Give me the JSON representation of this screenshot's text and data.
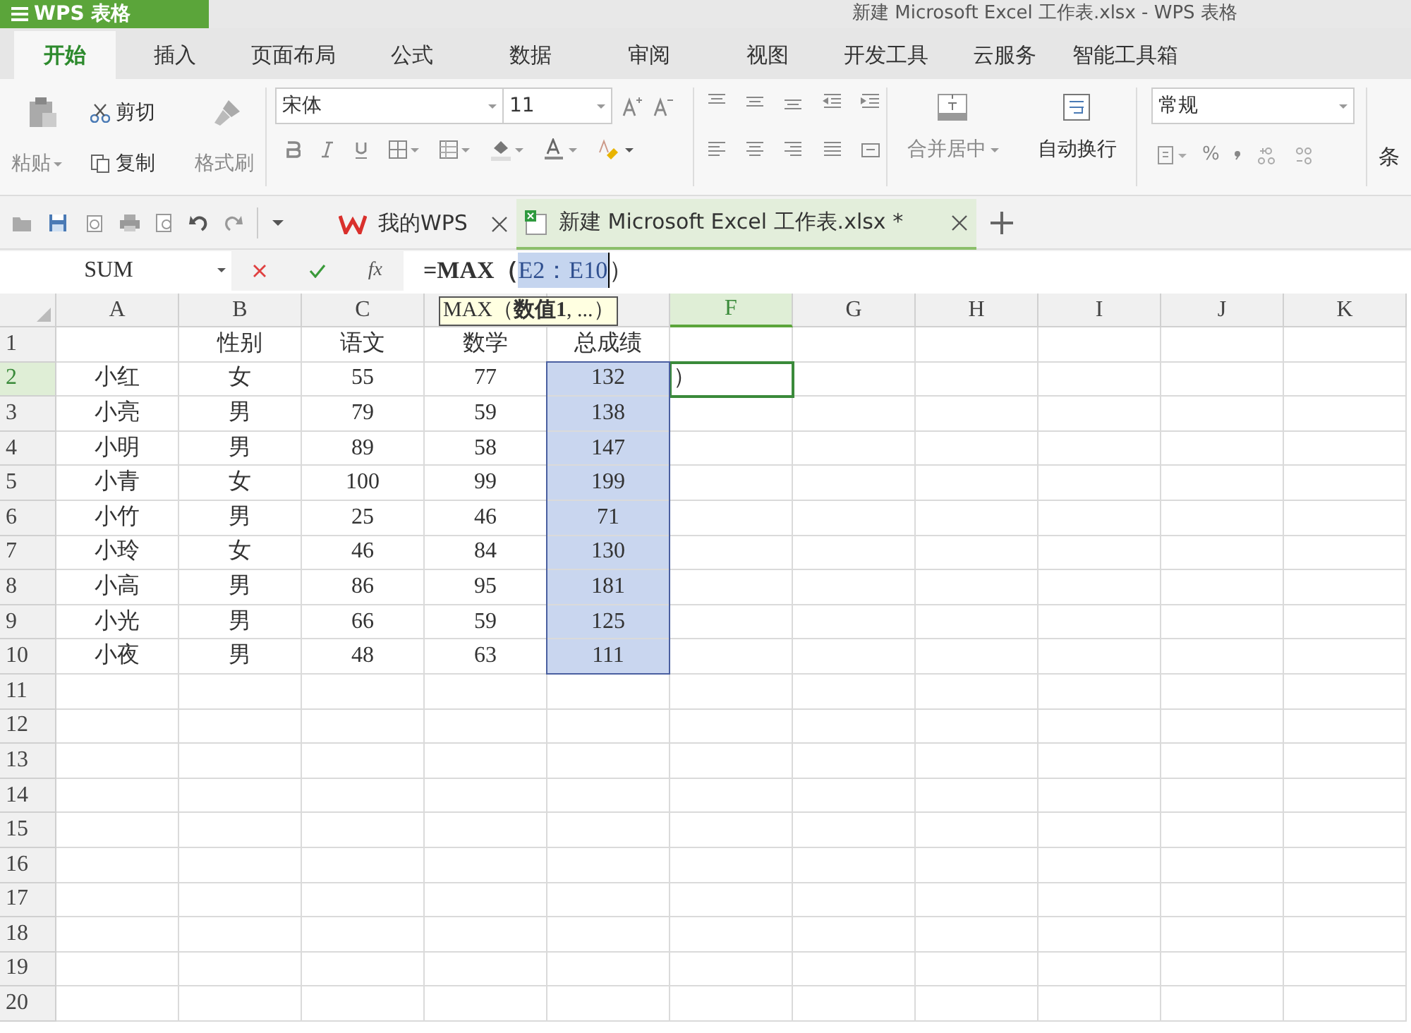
{
  "app_button": {
    "label": "WPS 表格"
  },
  "window": {
    "title": "新建 Microsoft Excel 工作表.xlsx  - WPS 表格"
  },
  "ribbon_tabs": [
    {
      "label": "开始",
      "selected": true
    },
    {
      "label": "插入",
      "selected": false
    },
    {
      "label": "页面布局",
      "selected": false
    },
    {
      "label": "公式",
      "selected": false
    },
    {
      "label": "数据",
      "selected": false
    },
    {
      "label": "审阅",
      "selected": false
    },
    {
      "label": "视图",
      "selected": false
    },
    {
      "label": "开发工具",
      "selected": false
    },
    {
      "label": "云服务",
      "selected": false
    },
    {
      "label": "智能工具箱",
      "selected": false
    }
  ],
  "ribbon": {
    "paste": "粘贴",
    "cut": "剪切",
    "copy": "复制",
    "format_painter": "格式刷",
    "font": "宋体",
    "font_size": "11",
    "merge_center": "合并居中",
    "wrap_text": "自动换行",
    "number_format": "常规",
    "percent": "%",
    "conditional": "条"
  },
  "doc_tabs": [
    {
      "label": "我的WPS",
      "selected": false
    },
    {
      "label": "新建 Microsoft Excel 工作表.xlsx *",
      "selected": true
    }
  ],
  "name_box": "SUM",
  "formula": {
    "fx": "fx",
    "before": "=MAX（",
    "reference": "E2：E10",
    "after": "）"
  },
  "tooltip": "MAX（**数值1**, ...）",
  "columns": [
    {
      "label": "A",
      "selected": false
    },
    {
      "label": "B",
      "selected": false
    },
    {
      "label": "C",
      "selected": false
    },
    {
      "selected": false
    },
    {
      "selected": false
    },
    {
      "label": "F",
      "selected": true
    },
    {
      "label": "G",
      "selected": false
    },
    {
      "label": "H",
      "selected": false
    },
    {
      "label": "I",
      "selected": false
    },
    {
      "label": "J",
      "selected": false
    },
    {
      "label": "K",
      "selected": false
    }
  ],
  "rows": [
    {
      "number": "1",
      "selected": false,
      "cells": [
        {
          "in_range": false
        },
        {
          "text": "性别",
          "in_range": false
        },
        {
          "text": "语文",
          "in_range": false
        },
        {
          "text": "数学",
          "in_range": false
        },
        {
          "text": "总成绩",
          "in_range": false
        }
      ]
    },
    {
      "number": "2",
      "selected": true,
      "cells": [
        {
          "text": "小红",
          "in_range": false
        },
        {
          "text": "女",
          "in_range": false
        },
        {
          "text": "55",
          "in_range": false
        },
        {
          "text": "77",
          "in_range": false
        },
        {
          "text": "132",
          "in_range": true
        },
        {
          "text": "）",
          "in_range": false
        }
      ]
    },
    {
      "number": "3",
      "selected": false,
      "cells": [
        {
          "text": "小亮",
          "in_range": false
        },
        {
          "text": "男",
          "in_range": false
        },
        {
          "text": "79",
          "in_range": false
        },
        {
          "text": "59",
          "in_range": false
        },
        {
          "text": "138",
          "in_range": true
        }
      ]
    },
    {
      "number": "4",
      "selected": false,
      "cells": [
        {
          "text": "小明",
          "in_range": false
        },
        {
          "text": "男",
          "in_range": false
        },
        {
          "text": "89",
          "in_range": false
        },
        {
          "text": "58",
          "in_range": false
        },
        {
          "text": "147",
          "in_range": true
        }
      ]
    },
    {
      "number": "5",
      "selected": false,
      "cells": [
        {
          "text": "小青",
          "in_range": false
        },
        {
          "text": "女",
          "in_range": false
        },
        {
          "text": "100",
          "in_range": false
        },
        {
          "text": "99",
          "in_range": false
        },
        {
          "text": "199",
          "in_range": true
        }
      ]
    },
    {
      "number": "6",
      "selected": false,
      "cells": [
        {
          "text": "小竹",
          "in_range": false
        },
        {
          "text": "男",
          "in_range": false
        },
        {
          "text": "25",
          "in_range": false
        },
        {
          "text": "46",
          "in_range": false
        },
        {
          "text": "71",
          "in_range": true
        }
      ]
    },
    {
      "number": "7",
      "selected": false,
      "cells": [
        {
          "text": "小玲",
          "in_range": false
        },
        {
          "text": "女",
          "in_range": false
        },
        {
          "text": "46",
          "in_range": false
        },
        {
          "text": "84",
          "in_range": false
        },
        {
          "text": "130",
          "in_range": true
        }
      ]
    },
    {
      "number": "8",
      "selected": false,
      "cells": [
        {
          "text": "小高",
          "in_range": false
        },
        {
          "text": "男",
          "in_range": false
        },
        {
          "text": "86",
          "in_range": false
        },
        {
          "text": "95",
          "in_range": false
        },
        {
          "text": "181",
          "in_range": true
        }
      ]
    },
    {
      "number": "9",
      "selected": false,
      "cells": [
        {
          "text": "小光",
          "in_range": false
        },
        {
          "text": "男",
          "in_range": false
        },
        {
          "text": "66",
          "in_range": false
        },
        {
          "text": "59",
          "in_range": false
        },
        {
          "text": "125",
          "in_range": true
        }
      ]
    },
    {
      "number": "10",
      "selected": false,
      "cells": [
        {
          "text": "小夜",
          "in_range": false
        },
        {
          "text": "男",
          "in_range": false
        },
        {
          "text": "48",
          "in_range": false
        },
        {
          "text": "63",
          "in_range": false
        },
        {
          "text": "111",
          "in_range": true
        }
      ]
    },
    {
      "number": "11",
      "selected": false
    },
    {
      "number": "12",
      "selected": false
    },
    {
      "number": "13",
      "selected": false
    },
    {
      "number": "14",
      "selected": false
    },
    {
      "number": "15",
      "selected": false
    },
    {
      "number": "16",
      "selected": false
    },
    {
      "number": "17",
      "selected": false
    },
    {
      "number": "18",
      "selected": false
    },
    {
      "number": "19",
      "selected": false
    },
    {
      "number": "20",
      "selected": false
    }
  ]
}
